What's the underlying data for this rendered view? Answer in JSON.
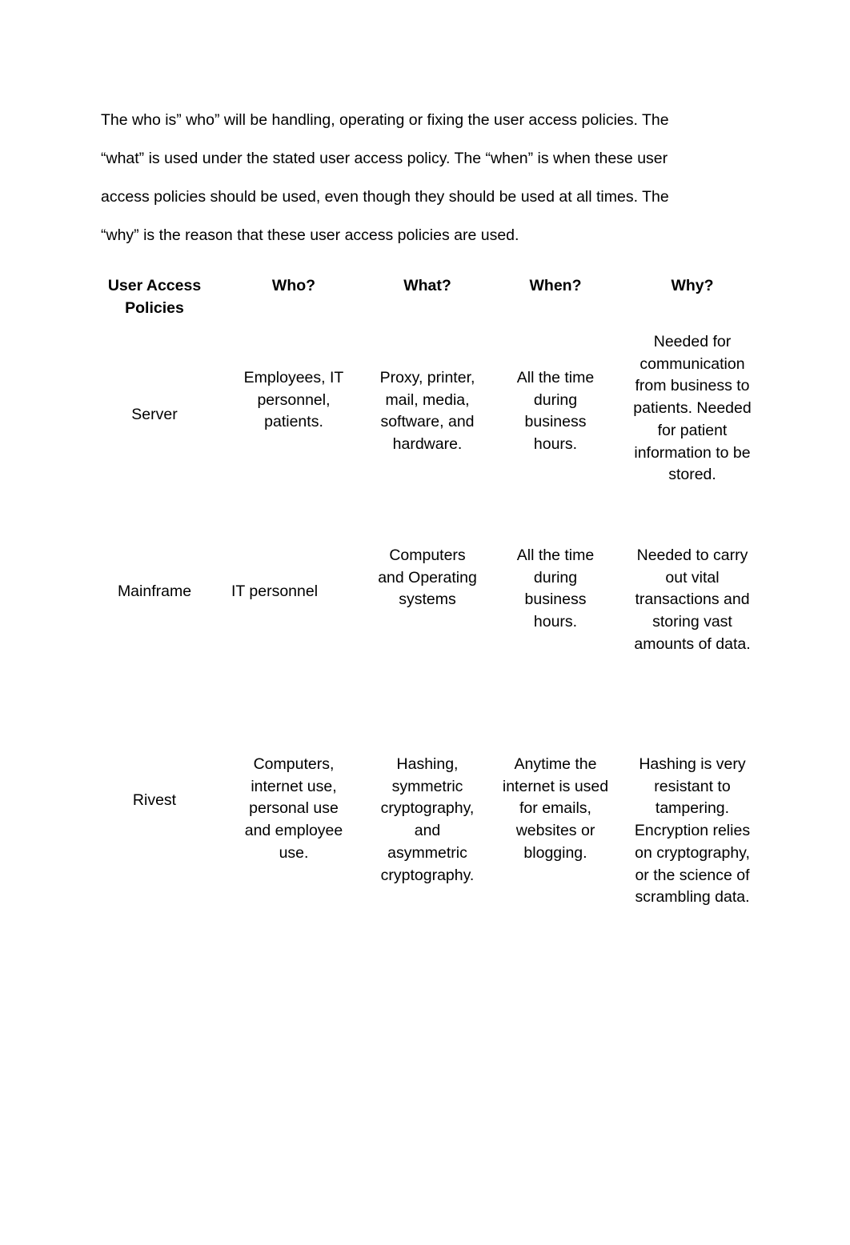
{
  "intro_paragraph": {
    "lines": [
      "The who is” who” will be handling, operating or fixing the user access policies. The",
      "“what” is used under the stated user access policy. The “when” is when these user",
      "access policies should be used, even though they should be used at all times. The",
      "“why” is the reason that these user access policies are used."
    ]
  },
  "table": {
    "headers": [
      [
        "User Access",
        "Policies"
      ],
      [
        "Who?"
      ],
      [
        "What?"
      ],
      [
        "When?"
      ],
      [
        "Why?"
      ]
    ],
    "rows": [
      {
        "policy": [
          "Server"
        ],
        "who": [
          "Employees, IT",
          "personnel,",
          "patients."
        ],
        "what": [
          "Proxy, printer,",
          "mail, media,",
          "software, and",
          "hardware."
        ],
        "when": [
          "All the time",
          "during",
          "business",
          "hours."
        ],
        "why": [
          "Needed for",
          "communication",
          "from business to",
          "patients. Needed",
          "for patient",
          "information to be",
          "stored."
        ]
      },
      {
        "policy": [
          "Mainframe"
        ],
        "who": [
          "IT personnel"
        ],
        "what": [
          "Computers",
          "and Operating",
          "systems"
        ],
        "when": [
          "All the time",
          "during",
          "business",
          "hours."
        ],
        "why": [
          "Needed to carry",
          "out vital",
          "transactions and",
          "storing vast",
          "amounts of data."
        ]
      },
      {
        "policy": [
          "Rivest"
        ],
        "who": [
          "Computers,",
          "internet use,",
          "personal use",
          "and employee",
          "use."
        ],
        "what": [
          "Hashing,",
          "symmetric",
          "cryptography,",
          "and",
          "asymmetric",
          "cryptography."
        ],
        "when": [
          "Anytime the",
          "internet is used",
          "for emails,",
          "websites or",
          "blogging."
        ],
        "why": [
          "Hashing is very",
          "resistant to",
          "tampering.",
          "Encryption relies",
          "on cryptography,",
          "or the science of",
          "scrambling data."
        ]
      }
    ]
  }
}
